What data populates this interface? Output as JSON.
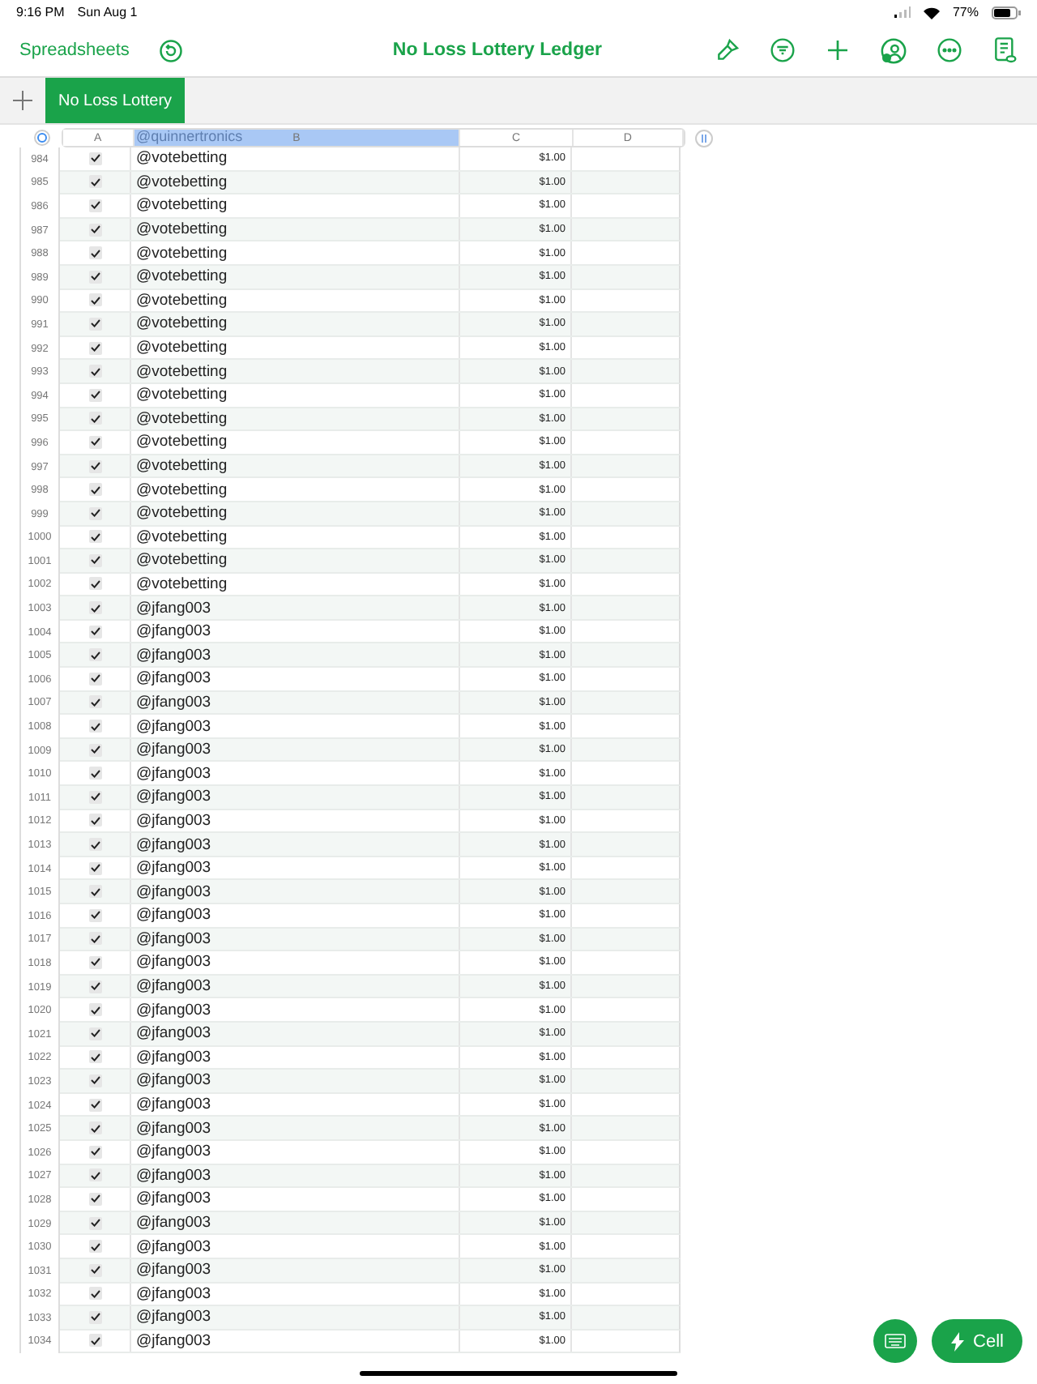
{
  "status_bar": {
    "time": "9:16 PM",
    "date": "Sun Aug 1",
    "battery": "77%"
  },
  "toolbar": {
    "back": "Spreadsheets",
    "title": "No Loss Lottery Ledger"
  },
  "sheet_tabs": [
    {
      "label": "No Loss Lottery",
      "selected": true
    }
  ],
  "table": {
    "columns": [
      {
        "label": "A",
        "selected": false
      },
      {
        "label": "B",
        "selected": true
      },
      {
        "label": "C",
        "selected": false
      },
      {
        "label": "D",
        "selected": false
      }
    ],
    "drag_ghost": "@quinnertronics",
    "rows": [
      {
        "n": "984",
        "checked": true,
        "b": "@votebetting",
        "c": "$1.00"
      },
      {
        "n": "985",
        "checked": true,
        "b": "@votebetting",
        "c": "$1.00"
      },
      {
        "n": "986",
        "checked": true,
        "b": "@votebetting",
        "c": "$1.00"
      },
      {
        "n": "987",
        "checked": true,
        "b": "@votebetting",
        "c": "$1.00"
      },
      {
        "n": "988",
        "checked": true,
        "b": "@votebetting",
        "c": "$1.00"
      },
      {
        "n": "989",
        "checked": true,
        "b": "@votebetting",
        "c": "$1.00"
      },
      {
        "n": "990",
        "checked": true,
        "b": "@votebetting",
        "c": "$1.00"
      },
      {
        "n": "991",
        "checked": true,
        "b": "@votebetting",
        "c": "$1.00"
      },
      {
        "n": "992",
        "checked": true,
        "b": "@votebetting",
        "c": "$1.00"
      },
      {
        "n": "993",
        "checked": true,
        "b": "@votebetting",
        "c": "$1.00"
      },
      {
        "n": "994",
        "checked": true,
        "b": "@votebetting",
        "c": "$1.00"
      },
      {
        "n": "995",
        "checked": true,
        "b": "@votebetting",
        "c": "$1.00"
      },
      {
        "n": "996",
        "checked": true,
        "b": "@votebetting",
        "c": "$1.00"
      },
      {
        "n": "997",
        "checked": true,
        "b": "@votebetting",
        "c": "$1.00"
      },
      {
        "n": "998",
        "checked": true,
        "b": "@votebetting",
        "c": "$1.00"
      },
      {
        "n": "999",
        "checked": true,
        "b": "@votebetting",
        "c": "$1.00"
      },
      {
        "n": "1000",
        "checked": true,
        "b": "@votebetting",
        "c": "$1.00"
      },
      {
        "n": "1001",
        "checked": true,
        "b": "@votebetting",
        "c": "$1.00"
      },
      {
        "n": "1002",
        "checked": true,
        "b": "@votebetting",
        "c": "$1.00"
      },
      {
        "n": "1003",
        "checked": true,
        "b": "@jfang003",
        "c": "$1.00"
      },
      {
        "n": "1004",
        "checked": true,
        "b": "@jfang003",
        "c": "$1.00"
      },
      {
        "n": "1005",
        "checked": true,
        "b": "@jfang003",
        "c": "$1.00"
      },
      {
        "n": "1006",
        "checked": true,
        "b": "@jfang003",
        "c": "$1.00"
      },
      {
        "n": "1007",
        "checked": true,
        "b": "@jfang003",
        "c": "$1.00"
      },
      {
        "n": "1008",
        "checked": true,
        "b": "@jfang003",
        "c": "$1.00"
      },
      {
        "n": "1009",
        "checked": true,
        "b": "@jfang003",
        "c": "$1.00"
      },
      {
        "n": "1010",
        "checked": true,
        "b": "@jfang003",
        "c": "$1.00"
      },
      {
        "n": "1011",
        "checked": true,
        "b": "@jfang003",
        "c": "$1.00"
      },
      {
        "n": "1012",
        "checked": true,
        "b": "@jfang003",
        "c": "$1.00"
      },
      {
        "n": "1013",
        "checked": true,
        "b": "@jfang003",
        "c": "$1.00"
      },
      {
        "n": "1014",
        "checked": true,
        "b": "@jfang003",
        "c": "$1.00"
      },
      {
        "n": "1015",
        "checked": true,
        "b": "@jfang003",
        "c": "$1.00"
      },
      {
        "n": "1016",
        "checked": true,
        "b": "@jfang003",
        "c": "$1.00"
      },
      {
        "n": "1017",
        "checked": true,
        "b": "@jfang003",
        "c": "$1.00"
      },
      {
        "n": "1018",
        "checked": true,
        "b": "@jfang003",
        "c": "$1.00"
      },
      {
        "n": "1019",
        "checked": true,
        "b": "@jfang003",
        "c": "$1.00"
      },
      {
        "n": "1020",
        "checked": true,
        "b": "@jfang003",
        "c": "$1.00"
      },
      {
        "n": "1021",
        "checked": true,
        "b": "@jfang003",
        "c": "$1.00"
      },
      {
        "n": "1022",
        "checked": true,
        "b": "@jfang003",
        "c": "$1.00"
      },
      {
        "n": "1023",
        "checked": true,
        "b": "@jfang003",
        "c": "$1.00"
      },
      {
        "n": "1024",
        "checked": true,
        "b": "@jfang003",
        "c": "$1.00"
      },
      {
        "n": "1025",
        "checked": true,
        "b": "@jfang003",
        "c": "$1.00"
      },
      {
        "n": "1026",
        "checked": true,
        "b": "@jfang003",
        "c": "$1.00"
      },
      {
        "n": "1027",
        "checked": true,
        "b": "@jfang003",
        "c": "$1.00"
      },
      {
        "n": "1028",
        "checked": true,
        "b": "@jfang003",
        "c": "$1.00"
      },
      {
        "n": "1029",
        "checked": true,
        "b": "@jfang003",
        "c": "$1.00"
      },
      {
        "n": "1030",
        "checked": true,
        "b": "@jfang003",
        "c": "$1.00"
      },
      {
        "n": "1031",
        "checked": true,
        "b": "@jfang003",
        "c": "$1.00"
      },
      {
        "n": "1032",
        "checked": true,
        "b": "@jfang003",
        "c": "$1.00"
      },
      {
        "n": "1033",
        "checked": true,
        "b": "@jfang003",
        "c": "$1.00"
      },
      {
        "n": "1034",
        "checked": true,
        "b": "@jfang003",
        "c": "$1.00"
      }
    ]
  },
  "actions": {
    "cell_button": "Cell"
  }
}
